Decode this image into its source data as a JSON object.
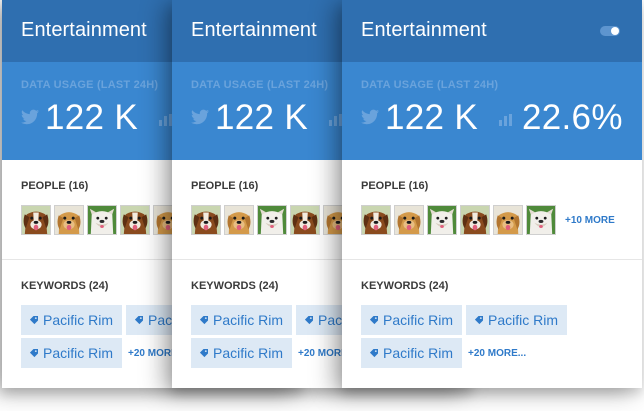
{
  "card": {
    "title": "Entertainment",
    "usage_label": "DATA USAGE (LAST 24H)",
    "usage_value": "122 K",
    "usage_percent": "22.6%",
    "people_label": "PEOPLE (16)",
    "more_people": "+10 MORE",
    "keywords_label": "KEYWORDS (24)",
    "tag_label": "Pacific Rim",
    "more_keywords": "+20 MORE...",
    "more_keywords_clipped": "+20 MORE"
  },
  "avatars": [
    "brown-dog",
    "golden-dog",
    "bulldog",
    "brown-dog",
    "golden-dog",
    "bulldog"
  ],
  "icons": {
    "twitter": "twitter-icon",
    "bars": "bar-chart-icon",
    "tag": "tag-icon",
    "toggle": "toggle-switch"
  },
  "colors": {
    "header": "#2f6fb0",
    "usage_panel": "#3a87d0",
    "accent": "#2f7ac9",
    "tag_bg": "#dde9f5"
  }
}
